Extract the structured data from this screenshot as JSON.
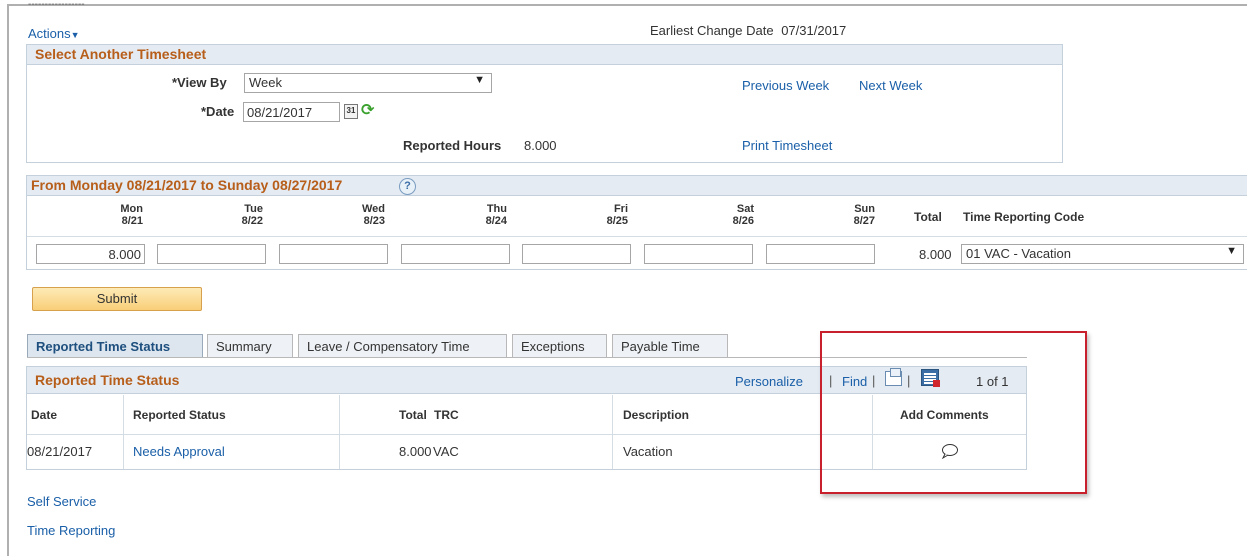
{
  "header": {
    "dashes": "-----------------",
    "actions_label": "Actions",
    "earliest_change_label": "Earliest Change Date",
    "earliest_change_value": "07/31/2017"
  },
  "select_timesheet": {
    "title": "Select Another Timesheet",
    "view_by_label": "*View By",
    "view_by_value": "Week",
    "date_label": "*Date",
    "date_value": "08/21/2017",
    "previous_week": "Previous Week",
    "next_week": "Next Week",
    "reported_hours_label": "Reported Hours",
    "reported_hours_value": "8.000",
    "print_timesheet": "Print Timesheet"
  },
  "timesheet": {
    "title": "From Monday 08/21/2017 to Sunday 08/27/2017",
    "help": "?",
    "days": [
      {
        "name": "Mon",
        "date": "8/21",
        "value": "8.000"
      },
      {
        "name": "Tue",
        "date": "8/22",
        "value": ""
      },
      {
        "name": "Wed",
        "date": "8/23",
        "value": ""
      },
      {
        "name": "Thu",
        "date": "8/24",
        "value": ""
      },
      {
        "name": "Fri",
        "date": "8/25",
        "value": ""
      },
      {
        "name": "Sat",
        "date": "8/26",
        "value": ""
      },
      {
        "name": "Sun",
        "date": "8/27",
        "value": ""
      }
    ],
    "total_header": "Total",
    "trc_header": "Time Reporting Code",
    "total_value": "8.000",
    "trc_value": "01 VAC - Vacation"
  },
  "submit_label": "Submit",
  "tabs": [
    {
      "label": "Reported Time Status",
      "active": true
    },
    {
      "label": "Summary",
      "active": false
    },
    {
      "label": "Leave / Compensatory Time",
      "active": false
    },
    {
      "label": "Exceptions",
      "active": false
    },
    {
      "label": "Payable Time",
      "active": false
    }
  ],
  "status_grid": {
    "title": "Reported Time Status",
    "personalize": "Personalize",
    "find": "Find",
    "pagination": "1 of 1",
    "columns": [
      "Date",
      "Reported Status",
      "Total",
      "TRC",
      "Description",
      "Add Comments"
    ],
    "rows": [
      {
        "date": "08/21/2017",
        "status": "Needs Approval",
        "total": "8.000",
        "trc": "VAC",
        "description": "Vacation"
      }
    ]
  },
  "footer_links": [
    "Self Service",
    "Time Reporting"
  ],
  "colors": {
    "link": "#1a5fa8",
    "section_title": "#b75e1a",
    "highlight_box": "#c8202c",
    "submit_bg": "#f9cf78"
  }
}
